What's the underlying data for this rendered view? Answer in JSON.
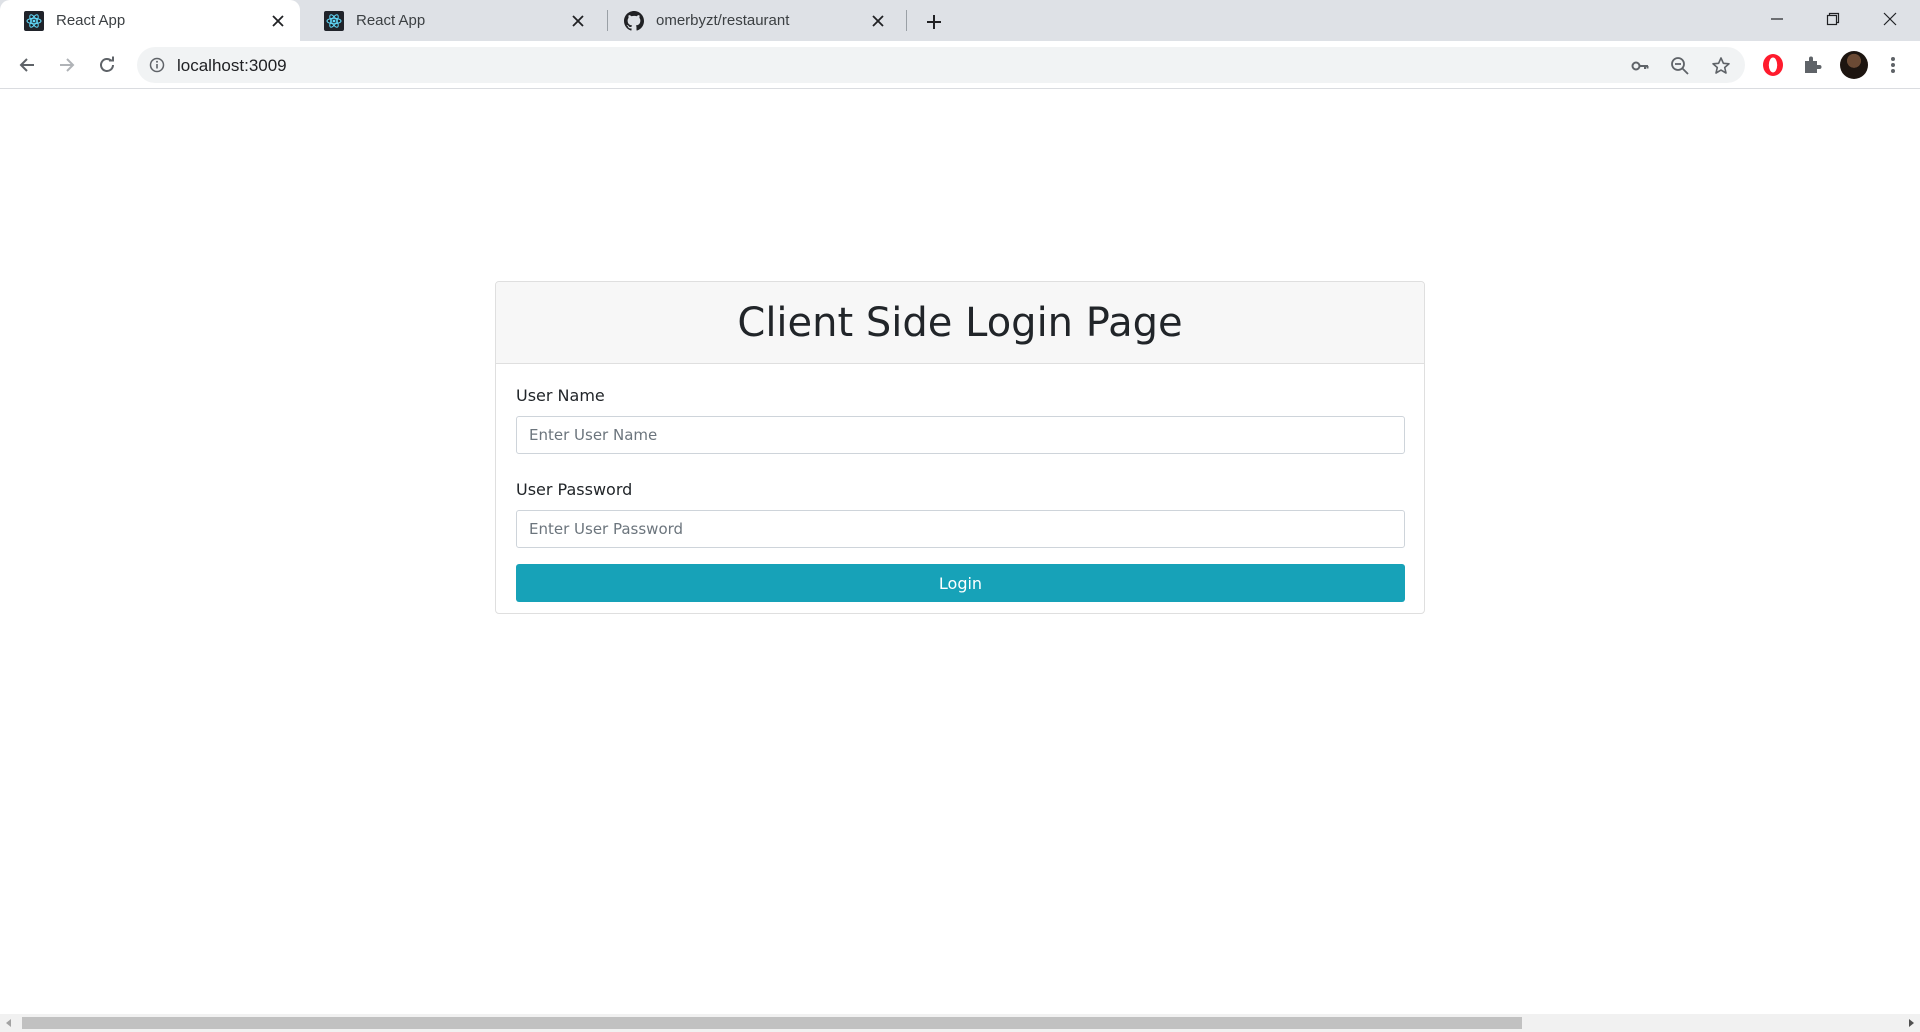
{
  "browser": {
    "tabs": [
      {
        "title": "React App",
        "icon": "react-icon",
        "active": true
      },
      {
        "title": "React App",
        "icon": "react-icon",
        "active": false
      },
      {
        "title": "omerbyzt/restaurant",
        "icon": "github-icon",
        "active": false
      }
    ],
    "url": "localhost:3009"
  },
  "login": {
    "title": "Client Side Login Page",
    "username_label": "User Name",
    "username_placeholder": "Enter User Name",
    "password_label": "User Password",
    "password_placeholder": "Enter User Password",
    "button_label": "Login"
  },
  "colors": {
    "accent": "#17a2b8",
    "tabstrip": "#dee1e6",
    "header_bg": "#f7f7f7"
  }
}
